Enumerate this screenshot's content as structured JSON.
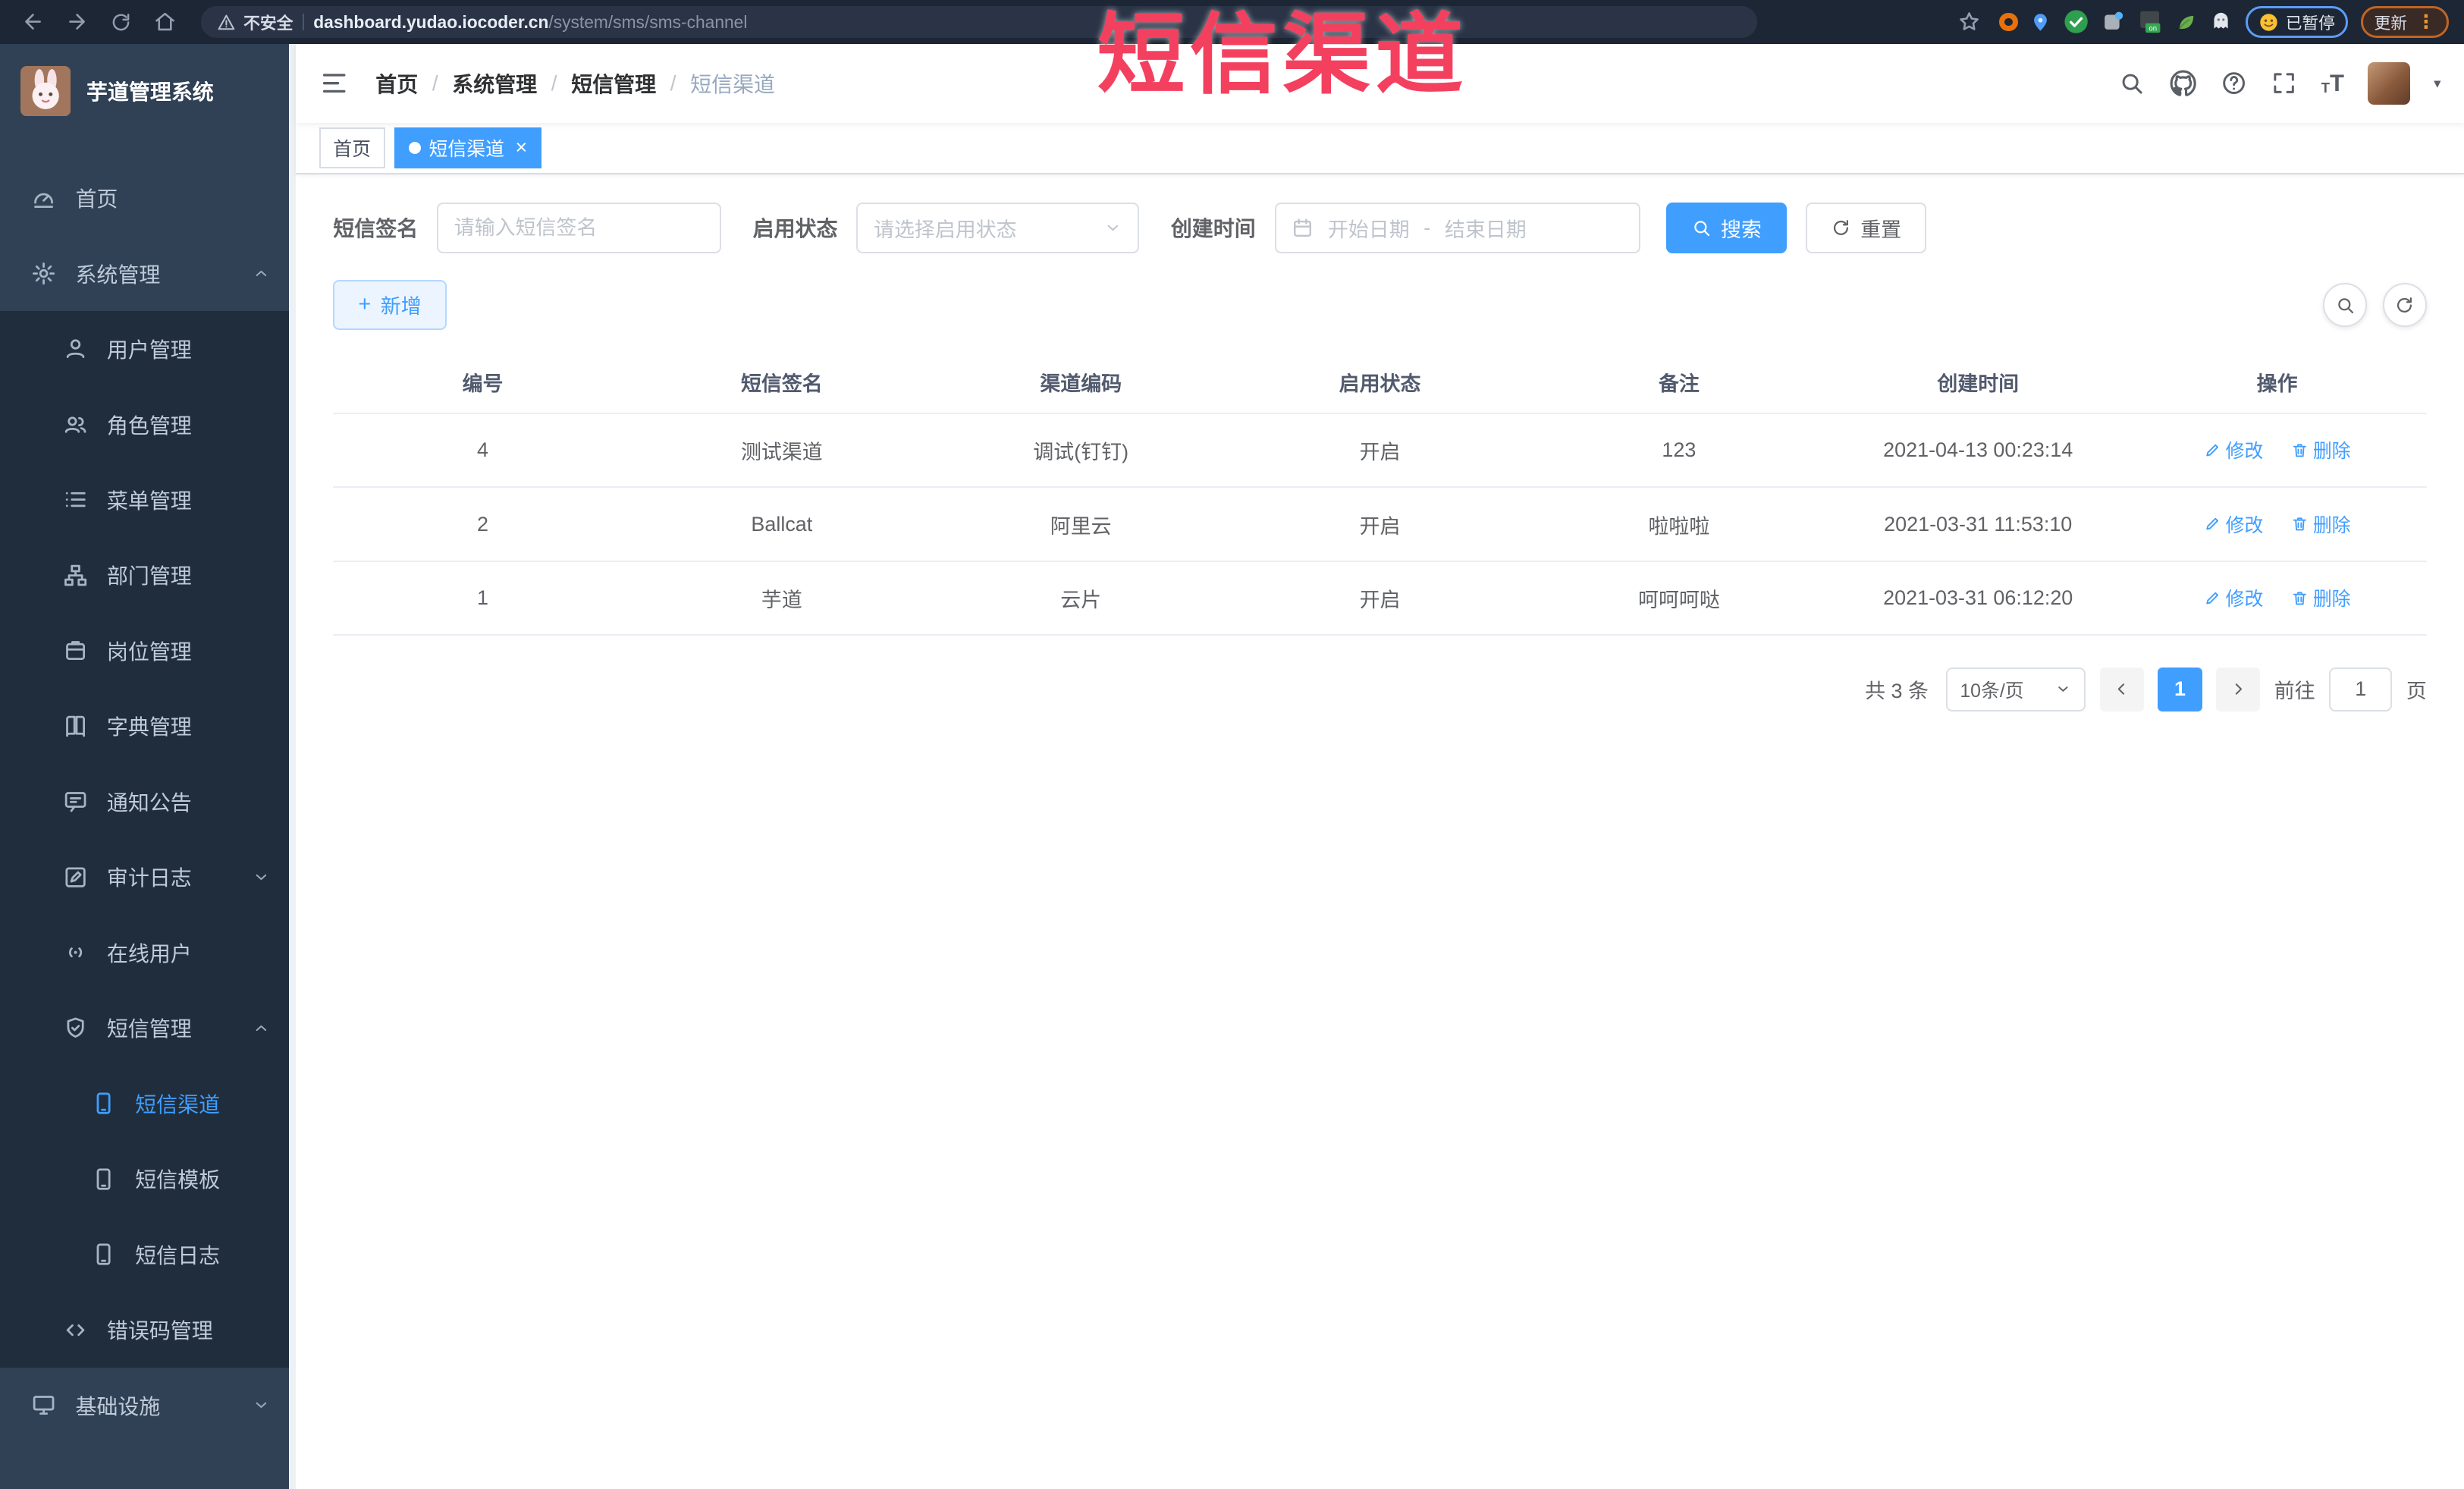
{
  "browser": {
    "security_warning": "不安全",
    "url_domain": "dashboard.yudao.iocoder.cn",
    "url_path": "/system/sms/sms-channel",
    "ext_badge": "on",
    "profile_badge": "已暂停",
    "update_label": "更新"
  },
  "watermark": {
    "text": "短信渠道"
  },
  "icons": {
    "close": "×",
    "caret_down": "▾",
    "kebab": "⋮",
    "plus": "+",
    "text_size": "T"
  },
  "sidebar": {
    "app_title": "芋道管理系统",
    "items": [
      {
        "label": "首页"
      },
      {
        "label": "系统管理"
      },
      {
        "label": "用户管理"
      },
      {
        "label": "角色管理"
      },
      {
        "label": "菜单管理"
      },
      {
        "label": "部门管理"
      },
      {
        "label": "岗位管理"
      },
      {
        "label": "字典管理"
      },
      {
        "label": "通知公告"
      },
      {
        "label": "审计日志"
      },
      {
        "label": "在线用户"
      },
      {
        "label": "短信管理"
      },
      {
        "label": "短信渠道"
      },
      {
        "label": "短信模板"
      },
      {
        "label": "短信日志"
      },
      {
        "label": "错误码管理"
      },
      {
        "label": "基础设施"
      }
    ]
  },
  "navbar": {
    "separator": "/",
    "breadcrumb": [
      "首页",
      "系统管理",
      "短信管理",
      "短信渠道"
    ]
  },
  "tags": [
    {
      "label": "首页"
    },
    {
      "label": "短信渠道"
    }
  ],
  "filters": {
    "sign_label": "短信签名",
    "sign_placeholder": "请输入短信签名",
    "status_label": "启用状态",
    "status_placeholder": "请选择启用状态",
    "time_label": "创建时间",
    "start_placeholder": "开始日期",
    "range_separator": "-",
    "end_placeholder": "结束日期",
    "search_label": "搜索",
    "reset_label": "重置"
  },
  "toolbar": {
    "add_label": "新增"
  },
  "table": {
    "headers": [
      "编号",
      "短信签名",
      "渠道编码",
      "启用状态",
      "备注",
      "创建时间",
      "操作"
    ],
    "edit_label": "修改",
    "delete_label": "删除",
    "rows": [
      {
        "id": "4",
        "sign": "测试渠道",
        "code": "调试(钉钉)",
        "status": "开启",
        "remark": "123",
        "created": "2021-04-13 00:23:14"
      },
      {
        "id": "2",
        "sign": "Ballcat",
        "code": "阿里云",
        "status": "开启",
        "remark": "啦啦啦",
        "created": "2021-03-31 11:53:10"
      },
      {
        "id": "1",
        "sign": "芋道",
        "code": "云片",
        "status": "开启",
        "remark": "呵呵呵哒",
        "created": "2021-03-31 06:12:20"
      }
    ]
  },
  "pagination": {
    "total_text": "共 3 条",
    "page_size": "10条/页",
    "current_page": "1",
    "goto_label": "前往",
    "goto_value": "1",
    "page_unit": "页"
  },
  "colors": {
    "accent": "#409eff",
    "watermark": "#f4405f",
    "sidebar_bg": "#304156",
    "submenu_bg": "#1f2d3d",
    "browser_bar_bg": "#1d2634",
    "tag_active_bg": "#409eff",
    "plain_button_bg": "#ecf5ff"
  }
}
